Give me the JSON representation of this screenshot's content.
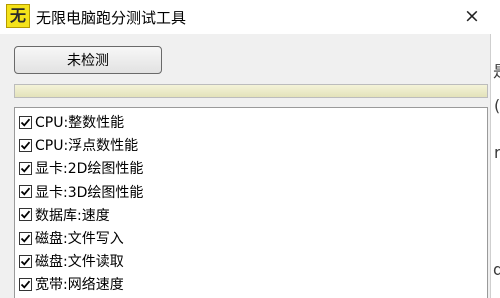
{
  "window": {
    "title": "无限电脑跑分测试工具",
    "icon_char": "无",
    "close_symbol": "×"
  },
  "toolbar": {
    "detect_label": "未检测"
  },
  "progress": {
    "value": 1.0
  },
  "checklist": [
    {
      "label": "CPU:整数性能",
      "checked": true
    },
    {
      "label": "CPU:浮点数性能",
      "checked": true
    },
    {
      "label": "显卡:2D绘图性能",
      "checked": true
    },
    {
      "label": "显卡:3D绘图性能",
      "checked": true
    },
    {
      "label": "数据库:速度",
      "checked": true
    },
    {
      "label": "磁盘:文件写入",
      "checked": true
    },
    {
      "label": "磁盘:文件读取",
      "checked": true
    },
    {
      "label": "宽带:网络速度",
      "checked": true
    }
  ],
  "background_fragments": [
    "是",
    "(",
    "r",
    "d"
  ]
}
